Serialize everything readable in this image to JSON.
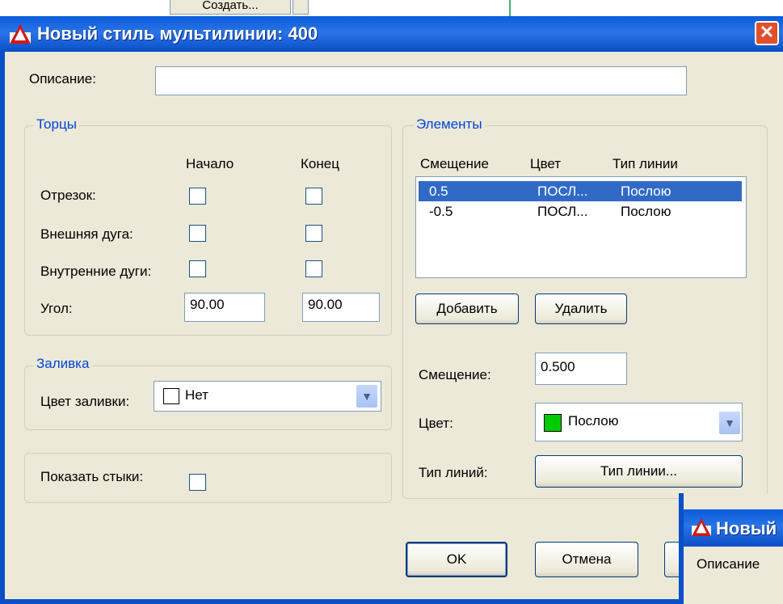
{
  "background": {
    "partial_button_label": "Создать..."
  },
  "window": {
    "title": "Новый стиль мультилинии: 400",
    "close_glyph": "✕",
    "accent_color": "#0a5bd9"
  },
  "description": {
    "label": "Описание:",
    "value": ""
  },
  "caps": {
    "title": "Торцы",
    "col_start": "Начало",
    "col_end": "Конец",
    "rows": [
      {
        "label": "Отрезок:",
        "start": false,
        "end": false
      },
      {
        "label": "Внешняя дуга:",
        "start": false,
        "end": false
      },
      {
        "label": "Внутренние дуги:",
        "start": false,
        "end": false
      }
    ],
    "angle": {
      "label": "Угол:",
      "start": "90.00",
      "end": "90.00"
    }
  },
  "fill": {
    "title": "Заливка",
    "label": "Цвет заливки:",
    "value": "Нет",
    "swatch_color": "#ffffff"
  },
  "joints": {
    "label": "Показать стыки:",
    "checked": false
  },
  "elements": {
    "title": "Элементы",
    "headers": [
      "Смещение",
      "Цвет",
      "Тип линии"
    ],
    "rows": [
      {
        "offset": "0.5",
        "color": "ПОСЛ...",
        "linetype": "Послою",
        "selected": true
      },
      {
        "offset": "-0.5",
        "color": "ПОСЛ...",
        "linetype": "Послою",
        "selected": false
      }
    ],
    "add_label": "Добавить",
    "delete_label": "Удалить",
    "offset_label": "Смещение:",
    "offset_value": "0.500",
    "color_label": "Цвет:",
    "color_value": "Послою",
    "color_swatch": "#00cc00",
    "linetype_label": "Тип линий:",
    "linetype_button": "Тип линии..."
  },
  "footer": {
    "ok_label": "OK",
    "cancel_label": "Отмена"
  },
  "second_dialog": {
    "title": "Новый",
    "label": "Описание"
  }
}
